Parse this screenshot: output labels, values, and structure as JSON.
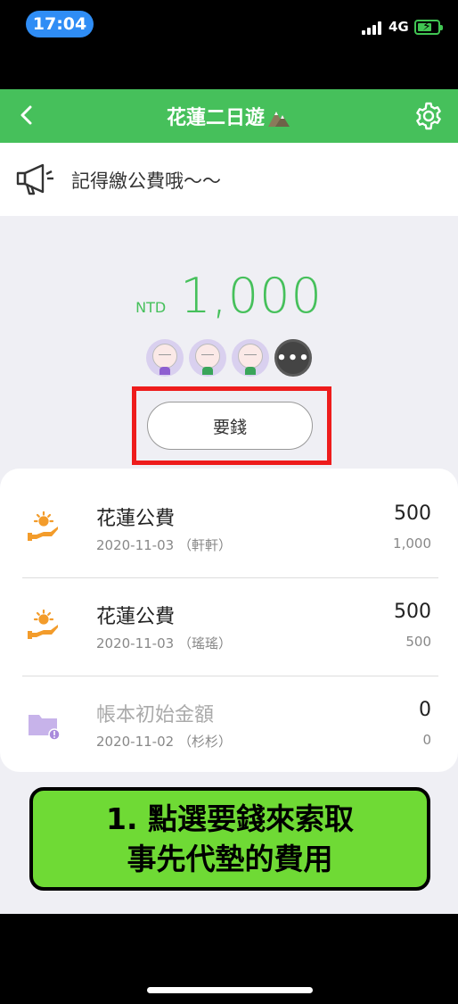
{
  "status_bar": {
    "time": "17:04",
    "network": "4G"
  },
  "header": {
    "title": "花蓮二日遊"
  },
  "announcement": {
    "text": "記得繳公費哦～～"
  },
  "summary": {
    "currency": "NTD",
    "amount": "1,000"
  },
  "request_button": {
    "label": "要錢"
  },
  "records": [
    {
      "title": "花蓮公費",
      "subtitle": "2020-11-03 （軒軒）",
      "amount": "500",
      "balance": "1,000",
      "icon": "sun-hand-icon"
    },
    {
      "title": "花蓮公費",
      "subtitle": "2020-11-03 （瑤瑤）",
      "amount": "500",
      "balance": "500",
      "icon": "sun-hand-icon"
    },
    {
      "title": "帳本初始金額",
      "subtitle": "2020-11-02 （杉杉）",
      "amount": "0",
      "balance": "0",
      "icon": "folder-alert-icon"
    }
  ],
  "annotation": {
    "line1": "1. 點選要錢來索取",
    "line2": "事先代墊的費用"
  },
  "colors": {
    "brand_green": "#46c05b",
    "highlight_red": "#ee1c1c",
    "annotation_green": "#6fda35",
    "accent_orange": "#f39c2b",
    "folder_purple": "#c7b3ea"
  }
}
